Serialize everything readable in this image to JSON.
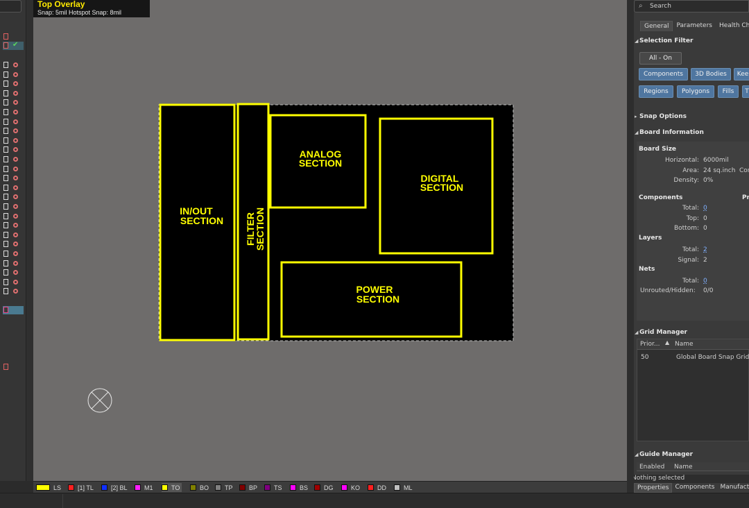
{
  "overlay": {
    "title": "Top Overlay",
    "snap_info": "Snap: 5mil Hotspot Snap: 8mil"
  },
  "board": {
    "sections": [
      {
        "name": "in-out",
        "lines": [
          "IN/OUT",
          "SECTION"
        ]
      },
      {
        "name": "filter",
        "lines": [
          "FILTER",
          "SECTION"
        ]
      },
      {
        "name": "analog",
        "lines": [
          "ANALOG",
          "SECTION"
        ]
      },
      {
        "name": "digital",
        "lines": [
          "DIGITAL",
          "SECTION"
        ]
      },
      {
        "name": "power",
        "lines": [
          "POWER",
          "SECTION"
        ]
      }
    ]
  },
  "layers": [
    {
      "label": "LS",
      "color": "#ffff00"
    },
    {
      "label": "[1] TL",
      "color": "#ff2020"
    },
    {
      "label": "[2] BL",
      "color": "#1030ff"
    },
    {
      "label": "M1",
      "color": "#ff20ff"
    },
    {
      "label": "TO",
      "color": "#ffff00"
    },
    {
      "label": "BO",
      "color": "#808000"
    },
    {
      "label": "TP",
      "color": "#808080"
    },
    {
      "label": "BP",
      "color": "#800000"
    },
    {
      "label": "TS",
      "color": "#800080"
    },
    {
      "label": "BS",
      "color": "#ff00ff"
    },
    {
      "label": "DG",
      "color": "#a00000"
    },
    {
      "label": "KO",
      "color": "#ff00ff"
    },
    {
      "label": "DD",
      "color": "#ff2020"
    },
    {
      "label": "ML",
      "color": "#c0c0c0"
    }
  ],
  "right": {
    "search_placeholder": "Search",
    "tabs": [
      "General",
      "Parameters",
      "Health Che"
    ],
    "selection_filter": {
      "title": "Selection Filter",
      "all_on": "All - On",
      "row1": [
        "Components",
        "3D Bodies",
        "Kee"
      ],
      "row2": [
        "Regions",
        "Polygons",
        "Fills",
        "T"
      ]
    },
    "snap_options": "Snap Options",
    "board_info": {
      "title": "Board Information",
      "board_size": "Board Size",
      "horizontal_label": "Horizontal:",
      "horizontal_value": "6000mil",
      "area_label": "Area:",
      "area_value": "24 sq.inch",
      "area_extra": "Con",
      "density_label": "Density:",
      "density_value": "0%",
      "components_label": "Components",
      "components_extra": "Pri",
      "comp_total_label": "Total:",
      "comp_total_value": "0",
      "comp_top_label": "Top:",
      "comp_top_value": "0",
      "comp_bottom_label": "Bottom:",
      "comp_bottom_value": "0",
      "layers_label": "Layers",
      "layers_total_label": "Total:",
      "layers_total_value": "2",
      "layers_signal_label": "Signal:",
      "layers_signal_value": "2",
      "nets_label": "Nets",
      "nets_total_label": "Total:",
      "nets_total_value": "0",
      "unrouted_label": "Unrouted/Hidden:",
      "unrouted_value": "0/0"
    },
    "grid_manager": {
      "title": "Grid Manager",
      "col_priority": "Prior...",
      "col_name": "Name",
      "row_priority": "50",
      "row_name": "Global Board Snap Grid"
    },
    "guide_manager": {
      "title": "Guide Manager",
      "col_enabled": "Enabled",
      "col_name": "Name"
    },
    "status": "Nothing selected",
    "bottom_tabs": [
      "Properties",
      "Components",
      "Manufact"
    ]
  }
}
